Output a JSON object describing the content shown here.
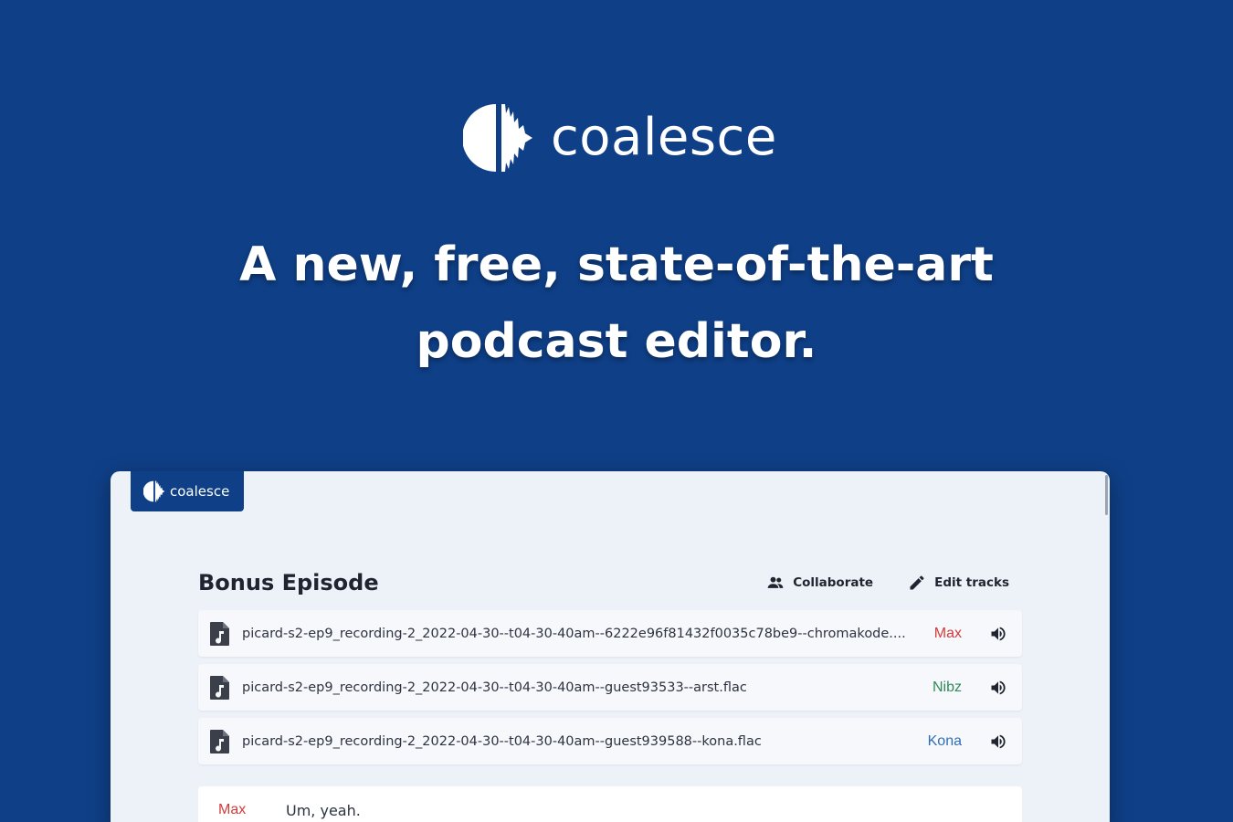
{
  "hero": {
    "brand": "coalesce",
    "headline_line1": "A new, free, state-of-the-art",
    "headline_line2": "podcast editor."
  },
  "app": {
    "brand": "coalesce",
    "episode_title": "Bonus Episode",
    "actions": {
      "collaborate": "Collaborate",
      "edit_tracks": "Edit tracks"
    },
    "tracks": [
      {
        "filename": "picard-s2-ep9_recording-2_2022-04-30--t04-30-40am--6222e96f81432f0035c78be9--chromakode....",
        "speaker": "Max",
        "speaker_color": "#d13b3b",
        "icon": "audio-file-icon"
      },
      {
        "filename": "picard-s2-ep9_recording-2_2022-04-30--t04-30-40am--guest93533--arst.flac",
        "speaker": "Nibz",
        "speaker_color": "#2f8a57",
        "icon": "audio-file-icon"
      },
      {
        "filename": "picard-s2-ep9_recording-2_2022-04-30--t04-30-40am--guest939588--kona.flac",
        "speaker": "Kona",
        "speaker_color": "#2f6fb8",
        "icon": "audio-file-icon"
      }
    ],
    "transcript": [
      {
        "speaker": "Max",
        "speaker_color": "#d13b3b",
        "text": "Um, yeah."
      }
    ]
  },
  "colors": {
    "background": "#0f3f87",
    "panel": "#edf1f8"
  }
}
